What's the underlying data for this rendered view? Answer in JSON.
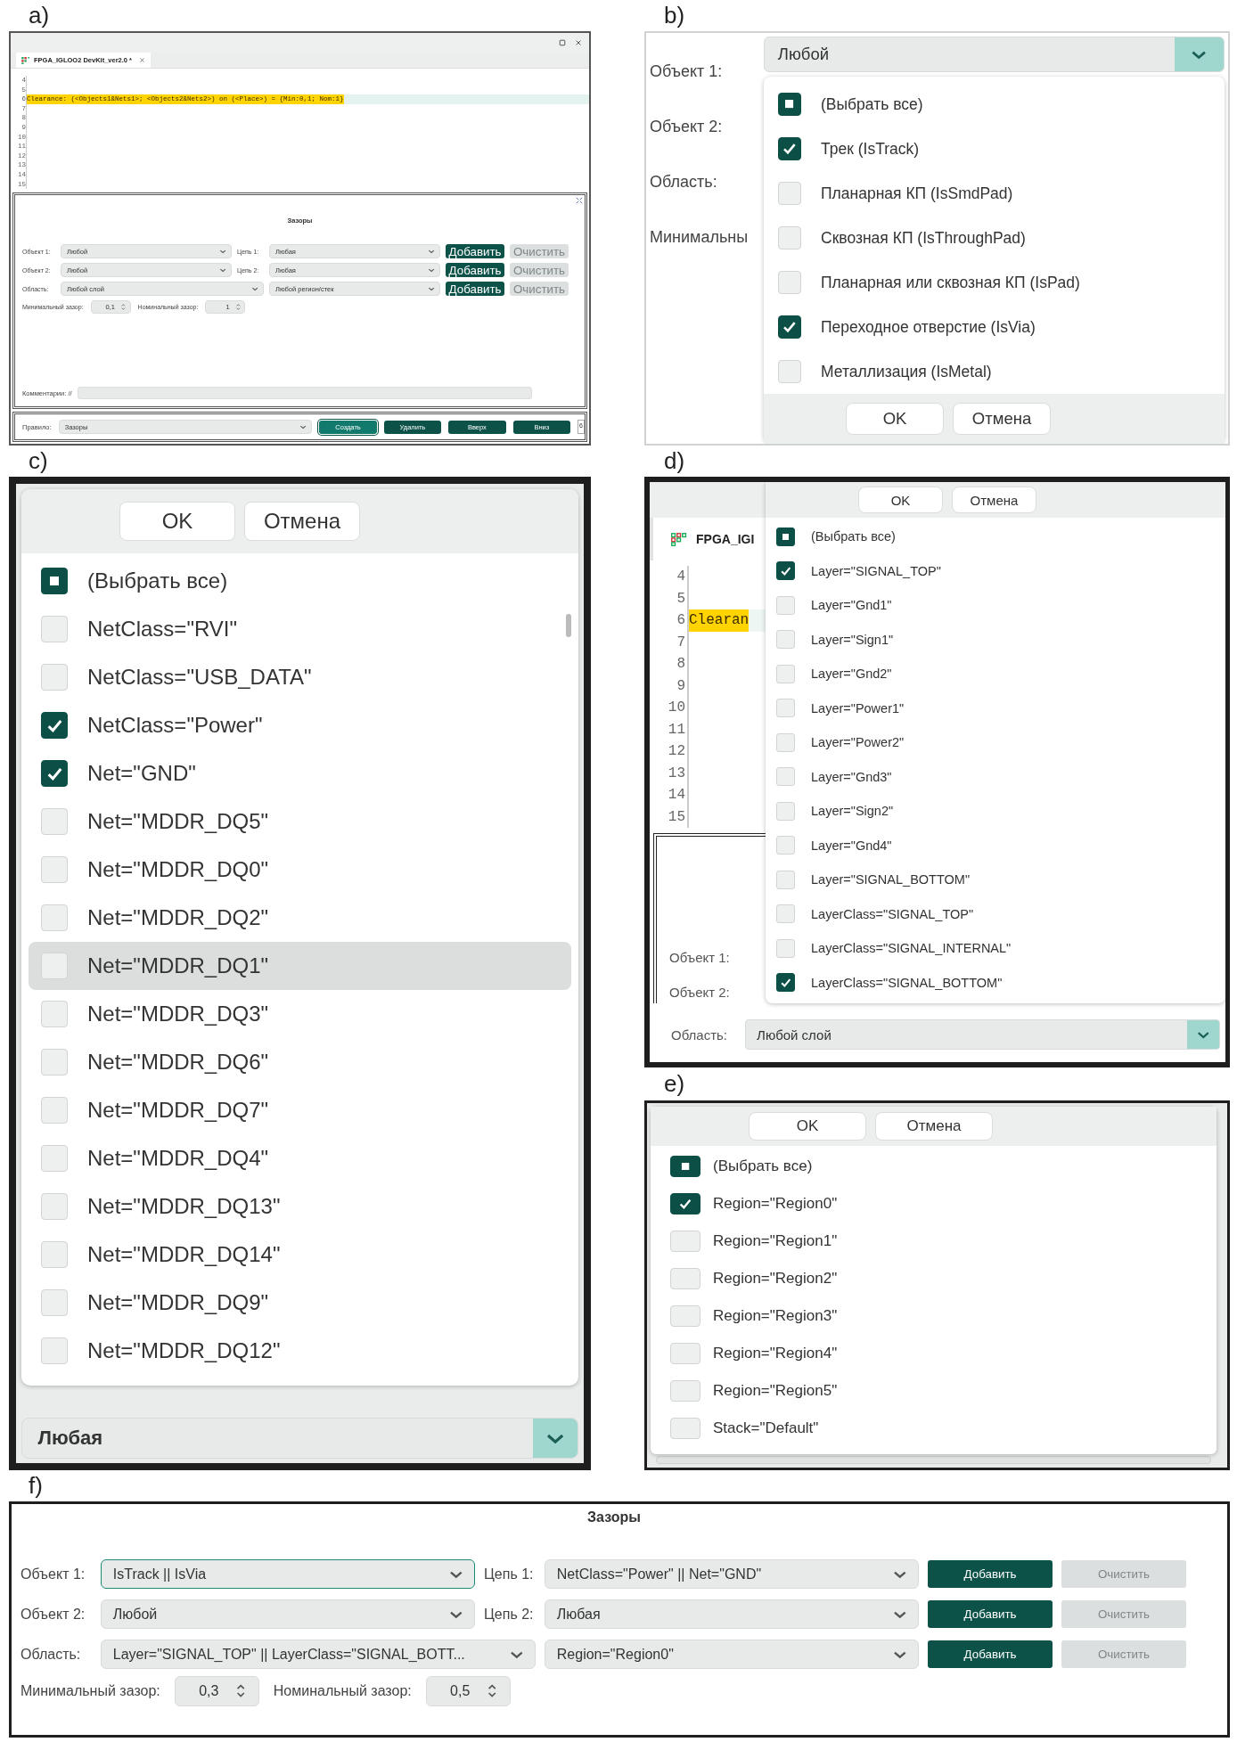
{
  "panel_a": {
    "label": "a)",
    "tab": {
      "title": "FPGA_IGLOO2 DevKit_ver2.0 *"
    },
    "lines": [
      {
        "number": "4",
        "highlighted": false
      },
      {
        "number": "5",
        "highlighted": false
      },
      {
        "number": "6",
        "text": "Clearance: (<Objects1&Nets1>; <Objects2&Nets2>) on (<Place>) = {Min:0,1; Nom:1}",
        "highlighted": true
      },
      {
        "number": "7",
        "highlighted": false
      },
      {
        "number": "8",
        "highlighted": false
      },
      {
        "number": "9",
        "highlighted": false
      },
      {
        "number": "10",
        "highlighted": false
      },
      {
        "number": "11",
        "highlighted": false
      },
      {
        "number": "12",
        "highlighted": false
      },
      {
        "number": "13",
        "highlighted": false
      },
      {
        "number": "14",
        "highlighted": false
      },
      {
        "number": "15",
        "highlighted": false
      }
    ],
    "form": {
      "title": "Зазоры",
      "rows": [
        {
          "label": "Объект 1:",
          "combo": {
            "value": "Любой",
            "focused": false
          },
          "label2": "Цепь 1:",
          "combo2": {
            "value": "Любая",
            "focused": false
          },
          "buttons": [
            {
              "text": "Добавить",
              "disabled": false
            },
            {
              "text": "Очистить",
              "disabled": true
            }
          ]
        },
        {
          "label": "Объект 2:",
          "combo": {
            "value": "Любой",
            "focused": false
          },
          "label2": "Цепь 2:",
          "combo2": {
            "value": "Любая",
            "focused": false
          },
          "buttons": [
            {
              "text": "Добавить",
              "disabled": false
            },
            {
              "text": "Очистить",
              "disabled": true
            }
          ]
        },
        {
          "label": "Область:",
          "combo": {
            "value": "Любой слой",
            "focused": false
          },
          "combo2": {
            "value": "Любой регион/стек",
            "focused": false
          },
          "buttons": [
            {
              "text": "Добавить",
              "disabled": false
            },
            {
              "text": "Очистить",
              "disabled": true
            }
          ]
        }
      ],
      "spins": [
        {
          "label": "Минимальный зазор:",
          "value": "0,1"
        },
        {
          "label": "Номинальный зазор:",
          "value": "1"
        }
      ],
      "comment": {
        "label": "Комментарии: //"
      }
    },
    "rule_bar": {
      "label": "Правило:",
      "combo": {
        "value": "Зазоры",
        "focused": false
      },
      "buttons": [
        {
          "text": "Создать",
          "focused": true
        },
        {
          "text": "Удалить",
          "focused": false
        },
        {
          "text": "Вверх",
          "focused": false
        },
        {
          "text": "Вниз",
          "focused": false
        }
      ],
      "counter": "6"
    }
  },
  "panel_b": {
    "label": "b)",
    "labels": [
      "Объект 1:",
      "Объект 2:",
      "Область:",
      "Минимальны"
    ],
    "combo": {
      "value": "Любой",
      "expanded": true
    },
    "dropdown": {
      "buttons": [
        "OK",
        "Отмена"
      ],
      "items": [
        {
          "kind": "select_all",
          "text": "(Выбрать все)",
          "indeterminate": true
        },
        {
          "kind": "option",
          "text": "Трек (IsTrack)",
          "checked": true
        },
        {
          "kind": "option",
          "text": "Планарная КП (IsSmdPad)",
          "checked": false
        },
        {
          "kind": "option",
          "text": "Сквозная КП (IsThroughPad)",
          "checked": false
        },
        {
          "kind": "option",
          "text": "Планарная или сквозная КП (IsPad)",
          "checked": false
        },
        {
          "kind": "option",
          "text": "Переходное отверстие (IsVia)",
          "checked": true
        },
        {
          "kind": "option",
          "text": "Металлизация (IsMetal)",
          "checked": false
        }
      ]
    }
  },
  "panel_c": {
    "label": "c)",
    "dropdown": {
      "buttons": [
        "OK",
        "Отмена"
      ],
      "items": [
        {
          "kind": "select_all",
          "text": "(Выбрать все)",
          "indeterminate": true,
          "highlighted": false
        },
        {
          "kind": "option",
          "text": "NetClass=\"RVI\"",
          "checked": false,
          "highlighted": false
        },
        {
          "kind": "option",
          "text": "NetClass=\"USB_DATA\"",
          "checked": false,
          "highlighted": false
        },
        {
          "kind": "option",
          "text": "NetClass=\"Power\"",
          "checked": true,
          "highlighted": false
        },
        {
          "kind": "option",
          "text": "Net=\"GND\"",
          "checked": true,
          "highlighted": false
        },
        {
          "kind": "option",
          "text": "Net=\"MDDR_DQ5\"",
          "checked": false,
          "highlighted": false
        },
        {
          "kind": "option",
          "text": "Net=\"MDDR_DQ0\"",
          "checked": false,
          "highlighted": false
        },
        {
          "kind": "option",
          "text": "Net=\"MDDR_DQ2\"",
          "checked": false,
          "highlighted": false
        },
        {
          "kind": "option",
          "text": "Net=\"MDDR_DQ1\"",
          "checked": false,
          "highlighted": true
        },
        {
          "kind": "option",
          "text": "Net=\"MDDR_DQ3\"",
          "checked": false,
          "highlighted": false
        },
        {
          "kind": "option",
          "text": "Net=\"MDDR_DQ6\"",
          "checked": false,
          "highlighted": false
        },
        {
          "kind": "option",
          "text": "Net=\"MDDR_DQ7\"",
          "checked": false,
          "highlighted": false
        },
        {
          "kind": "option",
          "text": "Net=\"MDDR_DQ4\"",
          "checked": false,
          "highlighted": false
        },
        {
          "kind": "option",
          "text": "Net=\"MDDR_DQ13\"",
          "checked": false,
          "highlighted": false
        },
        {
          "kind": "option",
          "text": "Net=\"MDDR_DQ14\"",
          "checked": false,
          "highlighted": false
        },
        {
          "kind": "option",
          "text": "Net=\"MDDR_DQ9\"",
          "checked": false,
          "highlighted": false
        },
        {
          "kind": "option",
          "text": "Net=\"MDDR_DQ12\"",
          "checked": false,
          "highlighted": false
        }
      ]
    },
    "combo": {
      "value": "Любая",
      "expanded": true
    }
  },
  "panel_d": {
    "label": "d)",
    "tab": {
      "title": "FPGA_IGI"
    },
    "lines": [
      {
        "number": "4",
        "highlighted": false
      },
      {
        "number": "5",
        "highlighted": false
      },
      {
        "number": "6",
        "text": "Clearan",
        "highlighted": true
      },
      {
        "number": "7",
        "highlighted": false
      },
      {
        "number": "8",
        "highlighted": false
      },
      {
        "number": "9",
        "highlighted": false
      },
      {
        "number": "10",
        "highlighted": false
      },
      {
        "number": "11",
        "highlighted": false
      },
      {
        "number": "12",
        "highlighted": false
      },
      {
        "number": "13",
        "highlighted": false
      },
      {
        "number": "14",
        "highlighted": false
      },
      {
        "number": "15",
        "highlighted": false
      }
    ],
    "labels": [
      "Объект 1:",
      "Объект 2:"
    ],
    "dropdown": {
      "buttons": [
        "OK",
        "Отмена"
      ],
      "items": [
        {
          "kind": "select_all",
          "text": "(Выбрать все)",
          "indeterminate": true
        },
        {
          "kind": "option",
          "text": "Layer=\"SIGNAL_TOP\"",
          "checked": true
        },
        {
          "kind": "option",
          "text": "Layer=\"Gnd1\"",
          "checked": false
        },
        {
          "kind": "option",
          "text": "Layer=\"Sign1\"",
          "checked": false
        },
        {
          "kind": "option",
          "text": "Layer=\"Gnd2\"",
          "checked": false
        },
        {
          "kind": "option",
          "text": "Layer=\"Power1\"",
          "checked": false
        },
        {
          "kind": "option",
          "text": "Layer=\"Power2\"",
          "checked": false
        },
        {
          "kind": "option",
          "text": "Layer=\"Gnd3\"",
          "checked": false
        },
        {
          "kind": "option",
          "text": "Layer=\"Sign2\"",
          "checked": false
        },
        {
          "kind": "option",
          "text": "Layer=\"Gnd4\"",
          "checked": false
        },
        {
          "kind": "option",
          "text": "Layer=\"SIGNAL_BOTTOM\"",
          "checked": false
        },
        {
          "kind": "option",
          "text": "LayerClass=\"SIGNAL_TOP\"",
          "checked": false
        },
        {
          "kind": "option",
          "text": "LayerClass=\"SIGNAL_INTERNAL\"",
          "checked": false
        },
        {
          "kind": "option",
          "text": "LayerClass=\"SIGNAL_BOTTOM\"",
          "checked": true
        }
      ]
    },
    "area": {
      "label": "Область:",
      "combo": {
        "value": "Любой слой",
        "expanded": true
      }
    }
  },
  "panel_e": {
    "label": "e)",
    "dropdown": {
      "buttons": [
        "OK",
        "Отмена"
      ],
      "items": [
        {
          "kind": "select_all",
          "text": "(Выбрать все)",
          "indeterminate": true
        },
        {
          "kind": "option",
          "text": "Region=\"Region0\"",
          "checked": true
        },
        {
          "kind": "option",
          "text": "Region=\"Region1\"",
          "checked": false
        },
        {
          "kind": "option",
          "text": "Region=\"Region2\"",
          "checked": false
        },
        {
          "kind": "option",
          "text": "Region=\"Region3\"",
          "checked": false
        },
        {
          "kind": "option",
          "text": "Region=\"Region4\"",
          "checked": false
        },
        {
          "kind": "option",
          "text": "Region=\"Region5\"",
          "checked": false
        },
        {
          "kind": "option",
          "text": "Stack=\"Default\"",
          "checked": false
        }
      ]
    }
  },
  "panel_f": {
    "label": "f)",
    "form": {
      "title": "Зазоры",
      "rows": [
        {
          "label": "Объект 1:",
          "combo": {
            "value": "IsTrack || IsVia",
            "focused": true
          },
          "label2": "Цепь 1:",
          "combo2": {
            "value": "NetClass=\"Power\" || Net=\"GND\"",
            "focused": false
          },
          "buttons": [
            {
              "text": "Добавить",
              "disabled": false
            },
            {
              "text": "Очистить",
              "disabled": true
            }
          ]
        },
        {
          "label": "Объект 2:",
          "combo": {
            "value": "Любой",
            "focused": false
          },
          "label2": "Цепь 2:",
          "combo2": {
            "value": "Любая",
            "focused": false
          },
          "buttons": [
            {
              "text": "Добавить",
              "disabled": false
            },
            {
              "text": "Очистить",
              "disabled": true
            }
          ]
        },
        {
          "label": "Область:",
          "combo": {
            "value": "Layer=\"SIGNAL_TOP\" || LayerClass=\"SIGNAL_BOTT...",
            "focused": false
          },
          "combo2": {
            "value": "Region=\"Region0\"",
            "focused": false
          },
          "buttons": [
            {
              "text": "Добавить",
              "disabled": false
            },
            {
              "text": "Очистить",
              "disabled": true
            }
          ]
        }
      ],
      "spins": [
        {
          "label": "Минимальный зазор:",
          "value": "0,3"
        },
        {
          "label": "Номинальный зазор:",
          "value": "0,5"
        }
      ]
    }
  }
}
